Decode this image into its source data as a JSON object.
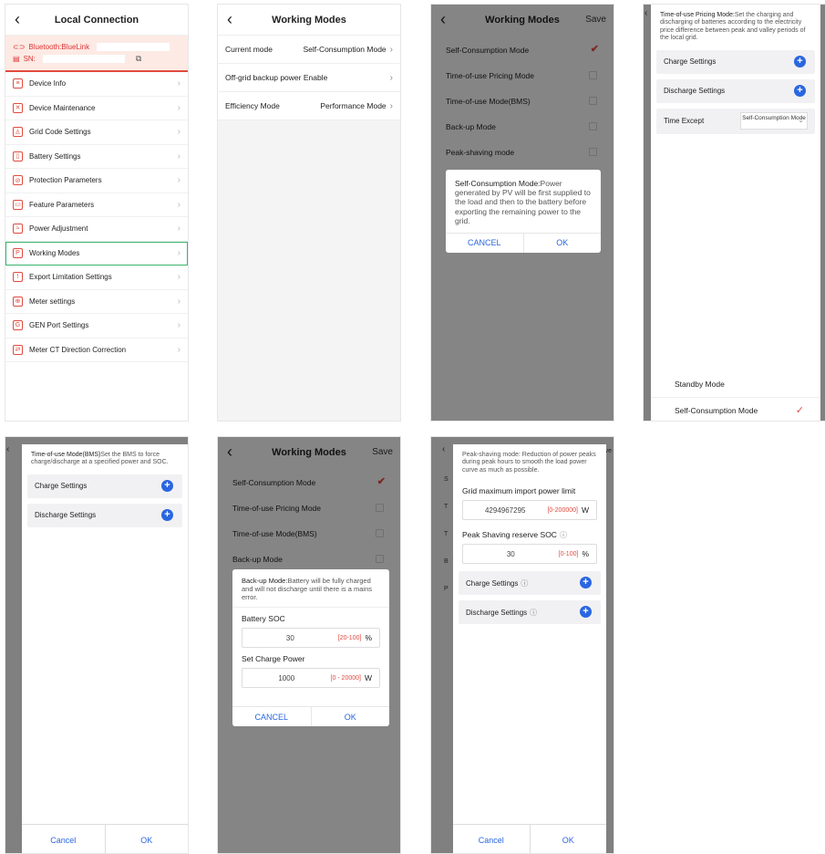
{
  "panel1": {
    "title": "Local Connection",
    "bluetooth": "Bluetooth:BlueLink",
    "sn_label": "SN:",
    "copy_icon": "copy-icon",
    "menu": [
      {
        "label": "Device Info",
        "icon": "list-icon",
        "symbol": "≡"
      },
      {
        "label": "Device Maintenance",
        "icon": "tools-icon",
        "symbol": "✕"
      },
      {
        "label": "Grid Code Settings",
        "icon": "person-icon",
        "symbol": "♙"
      },
      {
        "label": "Battery Settings",
        "icon": "battery-icon",
        "symbol": "▯"
      },
      {
        "label": "Protection Parameters",
        "icon": "shield-icon",
        "symbol": "⊘"
      },
      {
        "label": "Feature Parameters",
        "icon": "briefcase-icon",
        "symbol": "▭"
      },
      {
        "label": "Power Adjustment",
        "icon": "sliders-icon",
        "symbol": "≈"
      },
      {
        "label": "Working Modes",
        "icon": "mode-icon",
        "symbol": "P"
      },
      {
        "label": "Export Limitation Settings",
        "icon": "export-icon",
        "symbol": "!"
      },
      {
        "label": "Meter settings",
        "icon": "meter-icon",
        "symbol": "⊕"
      },
      {
        "label": "GEN Port Settings",
        "icon": "gen-icon",
        "symbol": "G"
      },
      {
        "label": "Meter CT Direction Correction",
        "icon": "ct-icon",
        "symbol": "⇄"
      }
    ],
    "active_index": 7,
    "accent": "#e04a3f",
    "highlight": "#3db36b"
  },
  "panel2": {
    "title": "Working Modes",
    "rows": [
      {
        "label": "Current mode",
        "value": "Self-Consumption Mode"
      },
      {
        "label": "Off-grid backup power Enable",
        "value": ""
      },
      {
        "label": "Efficiency Mode",
        "value": "Performance Mode"
      }
    ]
  },
  "panel3": {
    "title": "Working Modes",
    "save": "Save",
    "modes": [
      "Self-Consumption Mode",
      "Time-of-use Pricing Mode",
      "Time-of-use Mode(BMS)",
      "Back-up Mode",
      "Peak-shaving mode"
    ],
    "dialog_title": "Self-Consumption Mode:",
    "dialog_text": "Power generated by PV will be first supplied to the load and then to the battery before exporting the remaining power to the grid.",
    "cancel": "CANCEL",
    "ok": "OK"
  },
  "panel4": {
    "intro_title": "Time-of-use Pricing Mode:",
    "intro_text": "Set the charging and discharging of batteries according to the electricity price difference between peak and valley periods of the local grid.",
    "charge": "Charge Settings",
    "discharge": "Discharge Settings",
    "time_except": "Time Except",
    "select_value": "Self-Consumption Mode",
    "options": [
      "Standby Mode",
      "Self-Consumption Mode"
    ]
  },
  "panel5": {
    "intro_title": "Time-of-use Mode(BMS)",
    "intro_text": "Set the BMS to force charge/discharge at a specified power and SOC.",
    "charge": "Charge Settings",
    "discharge": "Discharge Settings",
    "cancel": "Cancel",
    "ok": "OK",
    "side_letters": "we"
  },
  "panel6": {
    "title": "Working Modes",
    "save": "Save",
    "modes": [
      "Self-Consumption Mode",
      "Time-of-use Pricing Mode",
      "Time-of-use Mode(BMS)",
      "Back-up Mode"
    ],
    "dialog_title": "Back-up Mode:",
    "dialog_text": "Battery will be fully charged and will not discharge until there is a mains error.",
    "soc_label": "Battery SOC",
    "soc_value": "30",
    "soc_range": "[20-100]",
    "soc_unit": "%",
    "power_label": "Set Charge Power",
    "power_value": "1000",
    "power_range": "[0 - 20000]",
    "power_unit": "W",
    "cancel": "CANCEL",
    "ok": "OK"
  },
  "panel7": {
    "intro": "Peak-shaving mode: Reduction of power peaks during peak hours to smooth the load power curve as much as possible.",
    "grid_label": "Grid maximum import power limit",
    "grid_value": "4294967295",
    "grid_range": "[0-200000]",
    "grid_unit": "W",
    "soc_label": "Peak Shaving reserve SOC",
    "soc_value": "30",
    "soc_range": "[0-100]",
    "soc_unit": "%",
    "charge": "Charge Settings",
    "discharge": "Discharge Settings",
    "cancel": "Cancel",
    "ok": "OK",
    "side_save": "ave",
    "side_letters": [
      "S",
      "T",
      "T",
      "B",
      "P"
    ]
  }
}
